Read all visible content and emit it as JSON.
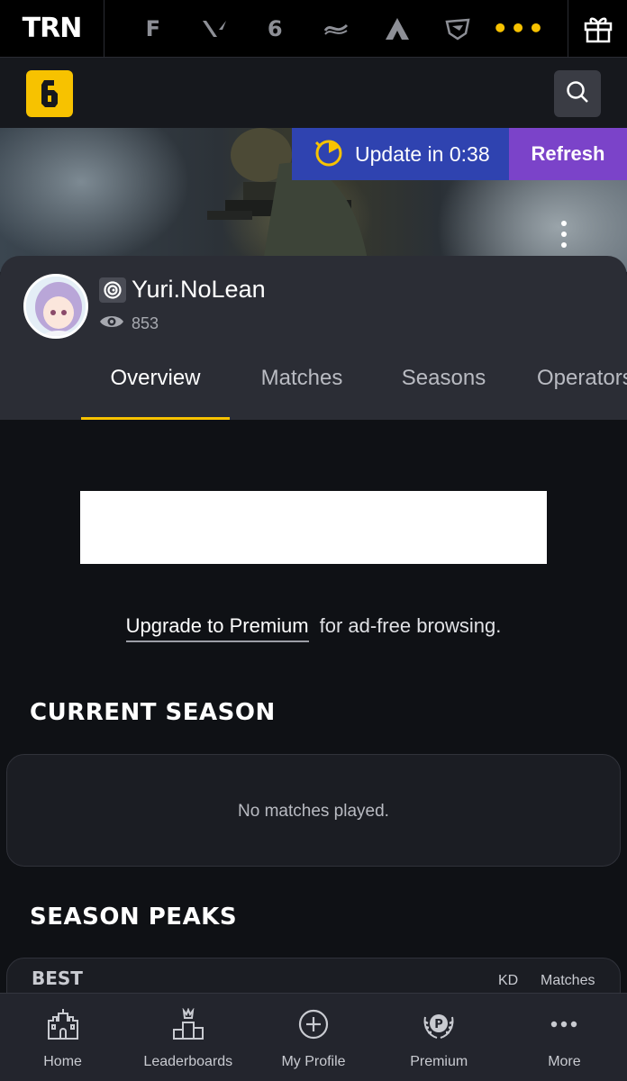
{
  "topbar": {
    "brand": "TRN",
    "games": [
      {
        "name": "fortnite",
        "glyph": "F"
      },
      {
        "name": "valorant",
        "glyph": "V"
      },
      {
        "name": "rainbow-six",
        "glyph": "6"
      },
      {
        "name": "halo",
        "glyph": "≈"
      },
      {
        "name": "apex-legends",
        "glyph": "A"
      },
      {
        "name": "rocket-league",
        "glyph": "R"
      }
    ],
    "more_glyph": "•••"
  },
  "navbar": {
    "logo_glyph": "6"
  },
  "banner": {
    "update_text": "Update in 0:38",
    "refresh_label": "Refresh"
  },
  "profile": {
    "username": "Yuri.NoLean",
    "views": "853",
    "tabs": [
      "Overview",
      "Matches",
      "Seasons",
      "Operators"
    ],
    "active_tab": "Overview"
  },
  "main": {
    "upsell_link": "Upgrade to Premium",
    "upsell_rest": "for ad-free browsing.",
    "current_season_title": "CURRENT SEASON",
    "no_matches_text": "No matches played.",
    "season_peaks_title": "SEASON PEAKS",
    "peaks_label": "BEST",
    "col_kd": "KD",
    "col_matches": "Matches"
  },
  "bottomnav": {
    "items": [
      {
        "label": "Home",
        "icon": "castle-icon"
      },
      {
        "label": "Leaderboards",
        "icon": "podium-icon"
      },
      {
        "label": "My Profile",
        "icon": "add-circle-icon"
      },
      {
        "label": "Premium",
        "icon": "premium-laurel-icon"
      },
      {
        "label": "More",
        "icon": "more-dots-icon"
      }
    ]
  },
  "colors": {
    "accent": "#f7c200",
    "update_bg": "#2f43b0",
    "refresh_bg": "#7b43c9",
    "page_bg": "#0f1115"
  }
}
